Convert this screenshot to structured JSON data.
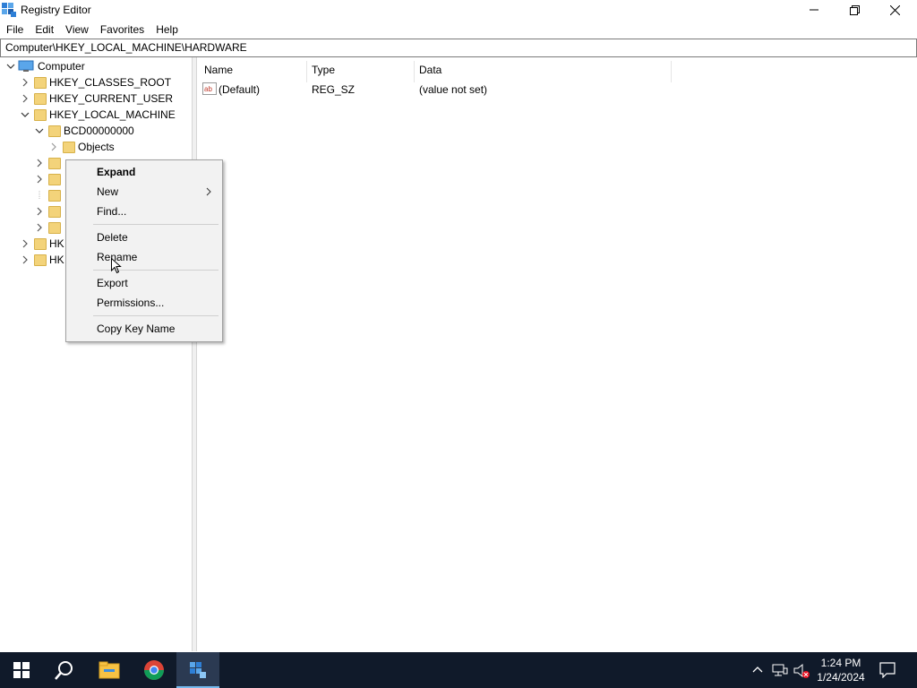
{
  "window": {
    "title": "Registry Editor",
    "minimize_icon": "minimize-icon",
    "maximize_icon": "restore-icon",
    "close_icon": "close-icon"
  },
  "menu": [
    "File",
    "Edit",
    "View",
    "Favorites",
    "Help"
  ],
  "address": "Computer\\HKEY_LOCAL_MACHINE\\HARDWARE",
  "tree": {
    "root": "Computer",
    "items": [
      {
        "label": "HKEY_CLASSES_ROOT"
      },
      {
        "label": "HKEY_CURRENT_USER"
      },
      {
        "label": "HKEY_LOCAL_MACHINE"
      },
      {
        "label": "BCD00000000"
      },
      {
        "label": "Objects"
      },
      {
        "label": "HK"
      },
      {
        "label": "HK"
      }
    ]
  },
  "list": {
    "columns": [
      "Name",
      "Type",
      "Data"
    ],
    "rows": [
      {
        "name": "(Default)",
        "type": "REG_SZ",
        "data": "(value not set)"
      }
    ]
  },
  "context_menu": {
    "items": [
      "Expand",
      "New",
      "Find...",
      "Delete",
      "Rename",
      "Export",
      "Permissions...",
      "Copy Key Name"
    ]
  },
  "taskbar": {
    "time": "1:24 PM",
    "date": "1/24/2024",
    "accent": "#76b9ed"
  }
}
